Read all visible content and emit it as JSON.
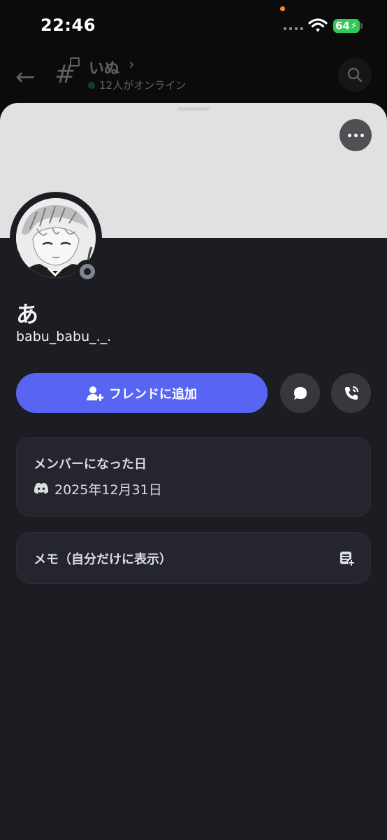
{
  "status_bar": {
    "time": "22:46",
    "battery": "64"
  },
  "channel_header": {
    "name": "いぬ",
    "chevron": "›",
    "online": "12人がオンライン"
  },
  "profile": {
    "display_name": "あ",
    "username": "babu_babu_._."
  },
  "actions": {
    "add_friend": "フレンドに追加"
  },
  "member_since": {
    "title": "メンバーになった日",
    "date": "2025年12月31日"
  },
  "note": {
    "label": "メモ（自分だけに表示）"
  },
  "colors": {
    "accent": "#5865f2",
    "sheet": "#1c1d22",
    "card": "#25262d",
    "banner": "#e1e1e1",
    "online": "#23a55a",
    "battery": "#34c759"
  },
  "icons": [
    "wifi-icon",
    "battery-icon",
    "back-arrow-icon",
    "channel-hash-icon",
    "search-icon",
    "more-icon",
    "add-friend-icon",
    "message-icon",
    "call-icon",
    "discord-icon",
    "note-add-icon"
  ]
}
